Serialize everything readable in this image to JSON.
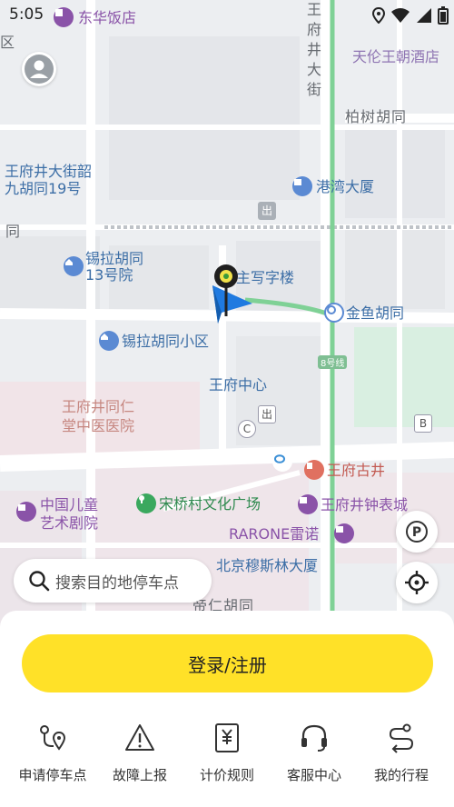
{
  "status_bar": {
    "time": "5:05"
  },
  "map": {
    "labels": {
      "dongHua": "东华饭店",
      "qu": "区",
      "wangfujingDajie": "王府井大街",
      "tianlun": "天伦王朝酒店",
      "baishu": "柏树胡同",
      "wangfujingDajieShao": "王府井大街韶",
      "jiuhutong19": "九胡同19号",
      "gangwan": "港湾大厦",
      "tong": "同",
      "xilaHutong13a": "锡拉胡同",
      "xilaHutong13b": "13号院",
      "zhuxie": "主写字楼",
      "jinyuHutong": "金鱼胡同",
      "xilaXiaoqu": "锡拉胡同小区",
      "line8": "8号线",
      "wangfujingCenter": "王府中心",
      "tongren1": "王府井同仁",
      "tongren2": "堂中医医院",
      "wangfuGujing": "王府古井",
      "ertong1": "中国儿童",
      "ertong2": "艺术剧院",
      "songqiao": "宋桥村文化广场",
      "zhongbiao": "王府井钟表城",
      "rarone": "RARONE雷诺",
      "muslim": "北京穆斯林大厦",
      "hutongBottom": "帝仁胡同",
      "icon_c": "C",
      "icon_b": "B",
      "icon_chu": "出"
    }
  },
  "search": {
    "placeholder": "搜索目的地停车点"
  },
  "login_button": "登录/注册",
  "actions": [
    {
      "label": "申请停车点",
      "icon": "route-pin-icon"
    },
    {
      "label": "故障上报",
      "icon": "warning-icon"
    },
    {
      "label": "计价规则",
      "icon": "price-doc-icon"
    },
    {
      "label": "客服中心",
      "icon": "headset-icon"
    },
    {
      "label": "我的行程",
      "icon": "trip-route-icon"
    }
  ],
  "colors": {
    "accent": "#ffe128",
    "map_bg": "#eceef1",
    "road": "#ffffff",
    "green_line": "#7fd196"
  }
}
